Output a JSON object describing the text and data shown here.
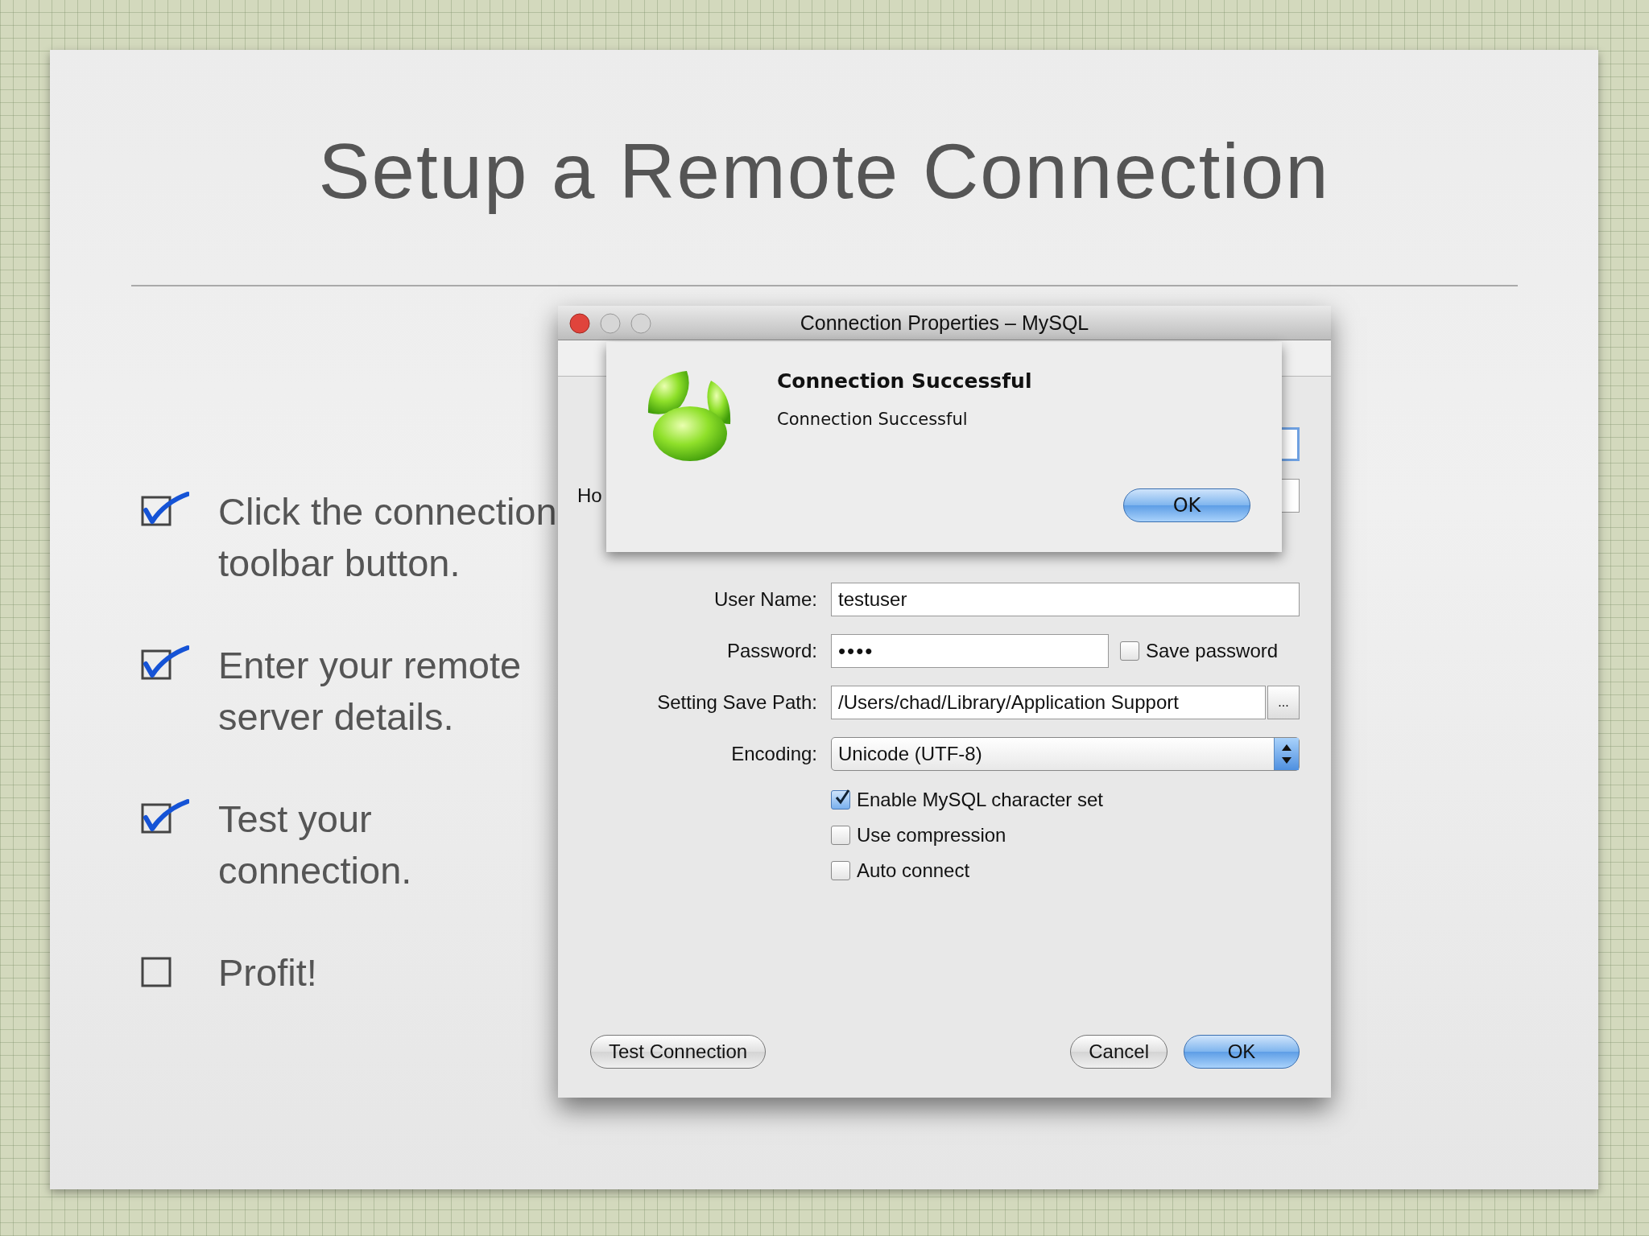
{
  "slide": {
    "title": "Setup a Remote Connection",
    "bullets": [
      {
        "text": "Click the connection toolbar button.",
        "checked": true
      },
      {
        "text": "Enter your remote server details.",
        "checked": true
      },
      {
        "text": "Test your connection.",
        "checked": true
      },
      {
        "text": "Profit!",
        "checked": false
      }
    ]
  },
  "dialog": {
    "title": "Connection Properties – MySQL",
    "fields": [
      {
        "kind": "covered",
        "focused": true
      },
      {
        "kind": "covered",
        "label": "Ho",
        "focused": false
      },
      {
        "kind": "text",
        "label": "User Name:",
        "value": "testuser"
      },
      {
        "kind": "password",
        "label": "Password:",
        "value": "••••",
        "option": {
          "label": "Save password",
          "checked": false
        }
      },
      {
        "kind": "path",
        "label": "Setting Save Path:",
        "value": "/Users/chad/Library/Application Support",
        "browse": "..."
      },
      {
        "kind": "select",
        "label": "Encoding:",
        "value": "Unicode (UTF-8)"
      }
    ],
    "checkboxes": [
      {
        "label": "Enable MySQL character set",
        "checked": true
      },
      {
        "label": "Use compression",
        "checked": false
      },
      {
        "label": "Auto connect",
        "checked": false
      }
    ],
    "buttons": [
      {
        "label": "Test Connection",
        "default": false
      },
      {
        "label": "Cancel",
        "default": false
      },
      {
        "label": "OK",
        "default": true
      }
    ],
    "alert": {
      "title": "Connection Successful",
      "message": "Connection Successful",
      "button": "OK"
    }
  }
}
